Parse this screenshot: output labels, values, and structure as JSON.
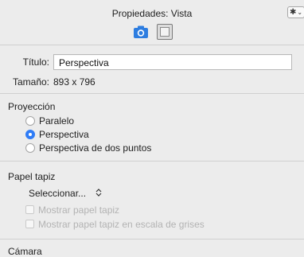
{
  "window": {
    "title": "Propiedades: Vista"
  },
  "toolbar": {
    "camera_icon": "camera-icon",
    "frame_icon": "frame-icon",
    "gear_glyph": "✱",
    "gear_caret": "⌄"
  },
  "fields": {
    "title_label": "Título:",
    "title_value": "Perspectiva",
    "size_label": "Tamaño:",
    "size_value": "893 x 796"
  },
  "projection": {
    "heading": "Proyección",
    "options": [
      {
        "label": "Paralelo",
        "selected": false
      },
      {
        "label": "Perspectiva",
        "selected": true
      },
      {
        "label": "Perspectiva de dos puntos",
        "selected": false
      }
    ]
  },
  "wallpaper": {
    "heading": "Papel tapiz",
    "select_label": "Seleccionar...",
    "select_arrows": "⌃⌄",
    "show_label": "Mostrar papel tapiz",
    "show_gray_label": "Mostrar papel tapiz en escala de grises"
  },
  "camera": {
    "heading": "Cámara"
  },
  "colors": {
    "accent": "#2f7cf6",
    "camera_icon": "#2d7de0"
  }
}
